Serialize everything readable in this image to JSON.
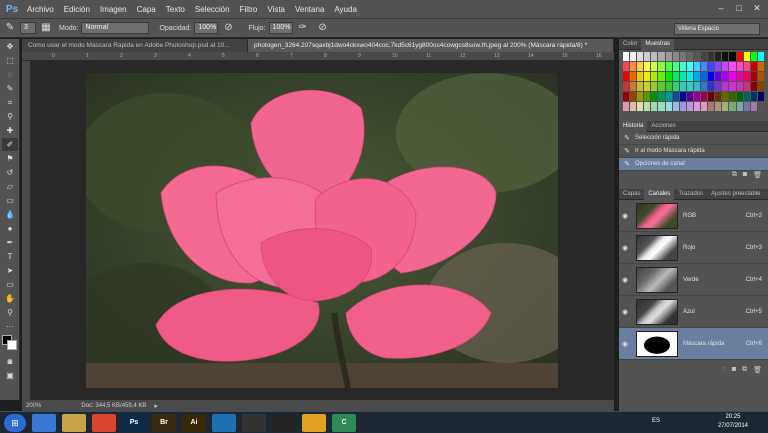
{
  "app": {
    "logo": "Ps"
  },
  "menu": [
    "Archivo",
    "Edición",
    "Imagen",
    "Capa",
    "Texto",
    "Selección",
    "Filtro",
    "Vista",
    "Ventana",
    "Ayuda"
  ],
  "options_bar": {
    "size": "3",
    "mode_label": "Modo:",
    "mode_value": "Normal",
    "opacity_label": "Opacidad:",
    "opacity_value": "100%",
    "flow_label": "Flujo:",
    "flow_value": "100%",
    "workspace": "Villena Espacio"
  },
  "doc_tabs": [
    {
      "label": "Como usar el modo Mascara Rapida en Adobe Photoshop.psd al 10...",
      "active": false
    },
    {
      "label": "photogen_3264.207sqaxbj1dwo4ckswo404coc.7kd5c61yg800os4cowgcs8sow.th.jpeg al 200% (Máscara rápida/8) *",
      "active": true
    }
  ],
  "ruler_marks": [
    "0",
    "1",
    "2",
    "3",
    "4",
    "5",
    "6",
    "7",
    "8",
    "9",
    "10",
    "11",
    "12",
    "13",
    "14",
    "15",
    "16"
  ],
  "status": {
    "zoom": "200%",
    "doc": "Doc: 344,5 KB/459,4 KB"
  },
  "panels": {
    "color_tabs": [
      "Color",
      "Muestras"
    ],
    "history_tabs": [
      "Historia",
      "Acciones"
    ],
    "history": [
      {
        "label": "Selección rápida",
        "icon": "quick-select-icon"
      },
      {
        "label": "Ir al modo Máscara rápida",
        "icon": "quick-mask-icon"
      },
      {
        "label": "Opciones de canal",
        "icon": "channel-options-icon"
      }
    ],
    "channel_tabs": [
      "Capas",
      "Canales",
      "Trazados",
      "Ajustes preestable"
    ],
    "channels": [
      {
        "name": "RGB",
        "key": "Ctrl+2"
      },
      {
        "name": "Rojo",
        "key": "Ctrl+3"
      },
      {
        "name": "Verde",
        "key": "Ctrl+4"
      },
      {
        "name": "Azul",
        "key": "Ctrl+5"
      },
      {
        "name": "Máscara rápida",
        "key": "Ctrl+6"
      }
    ]
  },
  "taskbar": {
    "apps": [
      {
        "label": "",
        "color": "#3a78d6",
        "icon": "tiles-icon"
      },
      {
        "label": "",
        "color": "#c8a24a",
        "icon": "folder-icon"
      },
      {
        "label": "",
        "color": "#d9442f",
        "icon": "chrome-icon"
      },
      {
        "label": "Ps",
        "color": "#0c2a4a",
        "icon": "photoshop-icon"
      },
      {
        "label": "Br",
        "color": "#3b2a12",
        "icon": "bridge-icon"
      },
      {
        "label": "Ai",
        "color": "#3a2608",
        "icon": "illustrator-icon"
      },
      {
        "label": "",
        "color": "#1f6fb3",
        "icon": "flash-icon"
      },
      {
        "label": "",
        "color": "#333",
        "icon": "tool-icon"
      },
      {
        "label": "",
        "color": "#222",
        "icon": "ninja-icon"
      },
      {
        "label": "",
        "color": "#e0a020",
        "icon": "bio-icon"
      },
      {
        "label": "C",
        "color": "#2e8b57",
        "icon": "camtasia-icon"
      }
    ],
    "lang": "ES",
    "time": "20:25",
    "date": "27/07/2014"
  },
  "colors": {
    "accent": "#6a7fa0",
    "flower": "#ef5a86"
  }
}
